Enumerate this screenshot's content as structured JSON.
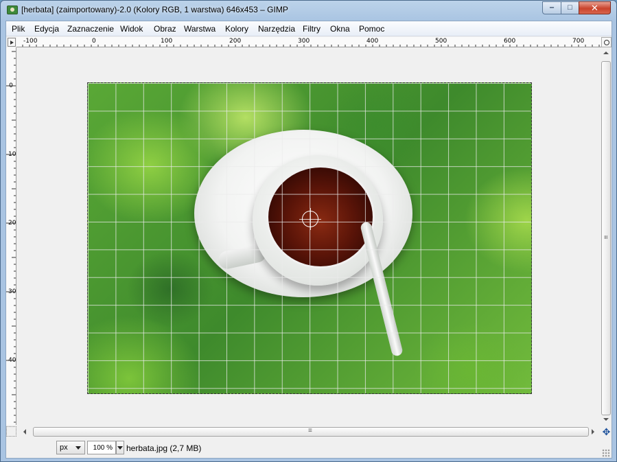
{
  "window": {
    "title": "[herbata] (zaimportowany)-2.0 (Kolory RGB, 1 warstwa) 646x453 – GIMP",
    "controls": {
      "minimize": "‒",
      "maximize": "□",
      "close": "✕"
    }
  },
  "menubar": {
    "items": [
      {
        "label": "Plik"
      },
      {
        "label": "Edycja"
      },
      {
        "label": "Zaznaczenie"
      },
      {
        "label": "Widok"
      },
      {
        "label": "Obraz"
      },
      {
        "label": "Warstwa"
      },
      {
        "label": "Kolory"
      },
      {
        "label": "Narzędzia"
      },
      {
        "label": "Filtry"
      },
      {
        "label": "Okna"
      },
      {
        "label": "Pomoc"
      }
    ]
  },
  "rulers": {
    "horizontal_labels": [
      "-100",
      "0",
      "100",
      "200",
      "300",
      "400",
      "500",
      "600",
      "700"
    ],
    "vertical_labels": [
      "0",
      "100",
      "200",
      "300",
      "400"
    ]
  },
  "canvas": {
    "image_name": "herbata",
    "image_width": 646,
    "image_height": 453,
    "grid": "on"
  },
  "statusbar": {
    "unit": "px",
    "zoom": "100 %",
    "file_info": "herbata.jpg (2,7 MB)"
  },
  "colors": {
    "title_bar": "#bcd3ea",
    "close_button": "#c9432c",
    "canvas_background": "#f0f0f0"
  }
}
